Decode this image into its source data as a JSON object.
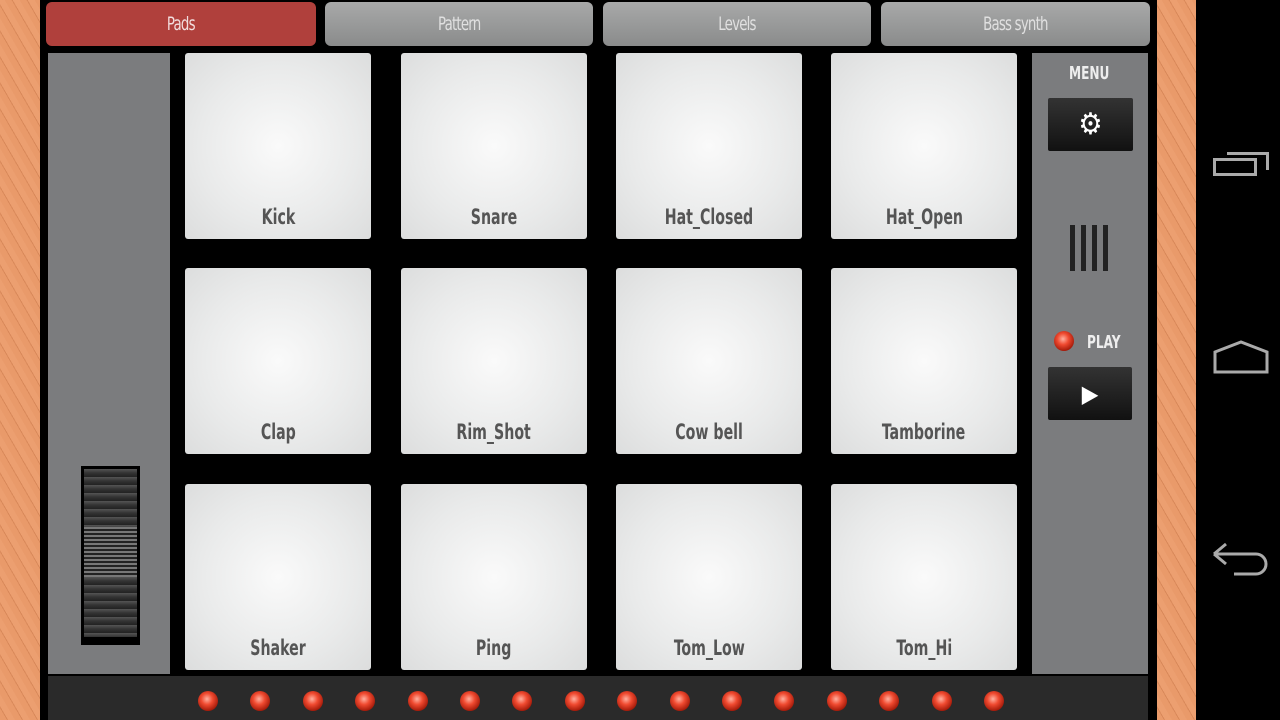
{
  "tabs": [
    {
      "label": "Pads",
      "active": true
    },
    {
      "label": "Pattern",
      "active": false
    },
    {
      "label": "Levels",
      "active": false
    },
    {
      "label": "Bass synth",
      "active": false
    }
  ],
  "pads": [
    "Kick",
    "Snare",
    "Hat_Closed",
    "Hat_Open",
    "Clap",
    "Rim_Shot",
    "Cow bell",
    "Tamborine",
    "Shaker",
    "Ping",
    "Tom_Low",
    "Tom_Hi"
  ],
  "right_panel": {
    "menu_label": "MENU",
    "menu_icon": "gear-icon",
    "play_label": "PLAY",
    "play_icon": "play-icon",
    "tempo_icon": "bars-icon"
  },
  "step_leds": {
    "count": 16,
    "color": "#e8402a"
  },
  "nav": {
    "recent": "recent-apps-icon",
    "home": "home-icon",
    "back": "back-icon"
  },
  "colors": {
    "active_tab": "#b0403c",
    "wood": "#e99a6a",
    "panel": "#7b7c7e"
  }
}
